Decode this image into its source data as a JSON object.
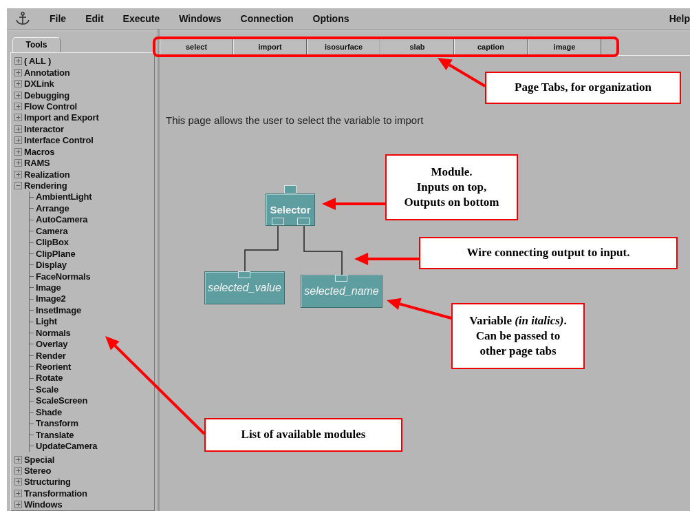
{
  "menu_bar": {
    "items": [
      "File",
      "Edit",
      "Execute",
      "Windows",
      "Connection",
      "Options"
    ],
    "help": "Help"
  },
  "tool_panel": {
    "tab": "Tools",
    "categories": [
      {
        "label": "( ALL )",
        "expanded": false
      },
      {
        "label": "Annotation",
        "expanded": false
      },
      {
        "label": "DXLink",
        "expanded": false
      },
      {
        "label": "Debugging",
        "expanded": false
      },
      {
        "label": "Flow Control",
        "expanded": false
      },
      {
        "label": "Import and Export",
        "expanded": false
      },
      {
        "label": "Interactor",
        "expanded": false
      },
      {
        "label": "Interface Control",
        "expanded": false
      },
      {
        "label": "Macros",
        "expanded": false
      },
      {
        "label": "RAMS",
        "expanded": false
      },
      {
        "label": "Realization",
        "expanded": false
      },
      {
        "label": "Rendering",
        "expanded": true,
        "children": [
          {
            "label": "AmbientLight"
          },
          {
            "label": "Arrange"
          },
          {
            "label": "AutoCamera"
          },
          {
            "label": "Camera"
          },
          {
            "label": "ClipBox"
          },
          {
            "label": "ClipPlane"
          },
          {
            "label": "Display"
          },
          {
            "label": "FaceNormals"
          },
          {
            "label": "Image"
          },
          {
            "label": "Image2"
          },
          {
            "label": "InsetImage"
          },
          {
            "label": "Light"
          },
          {
            "label": "Normals"
          },
          {
            "label": "Overlay"
          },
          {
            "label": "Render"
          },
          {
            "label": "Reorient"
          },
          {
            "label": "Rotate"
          },
          {
            "label": "Scale"
          },
          {
            "label": "ScaleScreen"
          },
          {
            "label": "Shade"
          },
          {
            "label": "Transform"
          },
          {
            "label": "Translate"
          },
          {
            "label": "UpdateCamera"
          }
        ]
      },
      {
        "label": "Special",
        "expanded": false
      },
      {
        "label": "Stereo",
        "expanded": false
      },
      {
        "label": "Structuring",
        "expanded": false
      },
      {
        "label": "Transformation",
        "expanded": false
      },
      {
        "label": "Windows",
        "expanded": false
      }
    ]
  },
  "page_tabs": [
    "select",
    "import",
    "isosurface",
    "slab",
    "caption",
    "image"
  ],
  "canvas": {
    "description": "This page allows the user to select the variable to import",
    "modules": [
      {
        "label": "Selector",
        "kind": "module"
      },
      {
        "label": "selected_value",
        "kind": "variable"
      },
      {
        "label": "selected_name",
        "kind": "variable"
      }
    ]
  },
  "annotations": [
    {
      "lines": [
        "Page Tabs, for organization"
      ]
    },
    {
      "lines": [
        "Module.",
        "Inputs on top,",
        "Outputs on bottom"
      ]
    },
    {
      "lines": [
        "Wire connecting output to input."
      ]
    },
    {
      "lines": [
        "Variable *(in italics)*.",
        "Can be passed to",
        "other page tabs"
      ]
    },
    {
      "lines": [
        "List of available modules"
      ]
    }
  ]
}
